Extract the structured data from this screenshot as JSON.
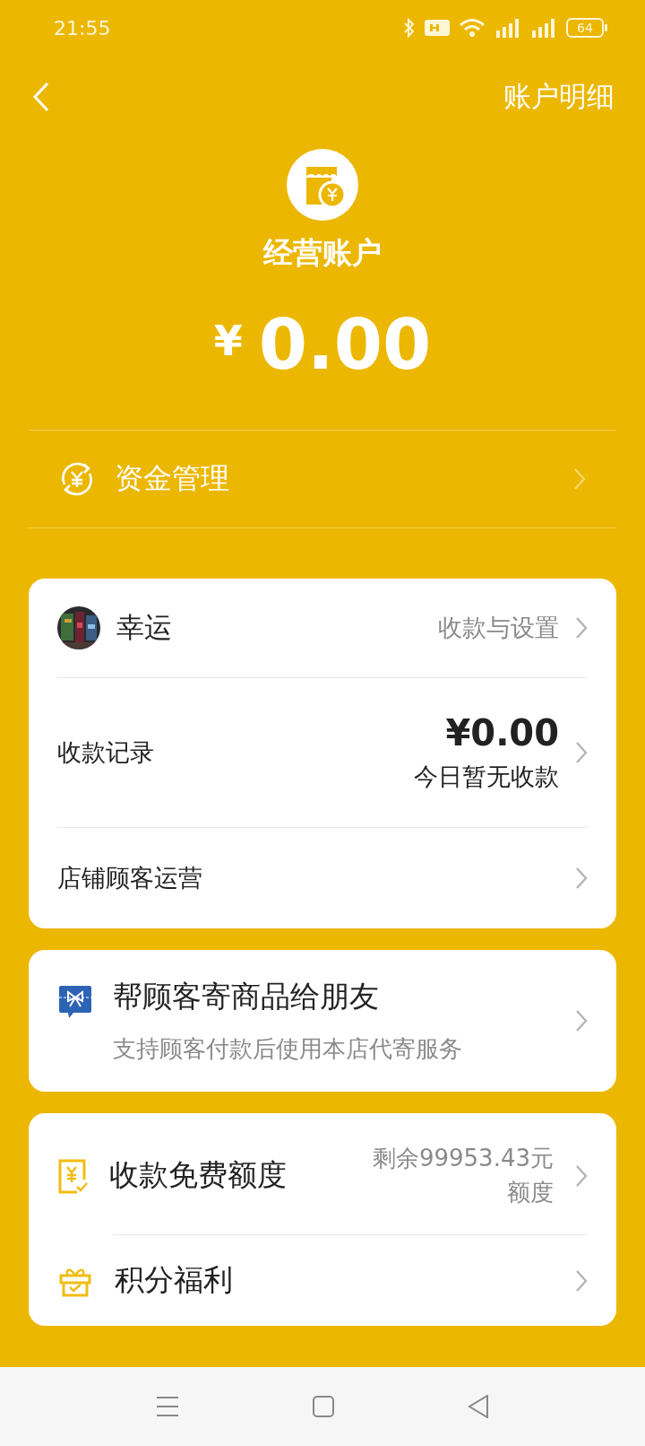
{
  "status_bar": {
    "time": "21:55",
    "battery": "64"
  },
  "header": {
    "title": "账户明细"
  },
  "account": {
    "name": "经营账户",
    "currency": "¥",
    "balance": "0.00"
  },
  "fund_management": {
    "label": "资金管理"
  },
  "store_card": {
    "store_name": "幸运",
    "settings_link": "收款与设置",
    "records": {
      "label": "收款记录",
      "amount": "¥0.00",
      "note": "今日暂无收款"
    },
    "operations": {
      "label": "店铺顾客运营"
    }
  },
  "gift_card": {
    "title": "帮顾客寄商品给朋友",
    "subtitle": "支持顾客付款后使用本店代寄服务"
  },
  "benefits": [
    {
      "kind": "quota",
      "label": "收款免费额度",
      "detail": "剩余99953.43元额度"
    },
    {
      "kind": "points",
      "label": "积分福利"
    }
  ]
}
